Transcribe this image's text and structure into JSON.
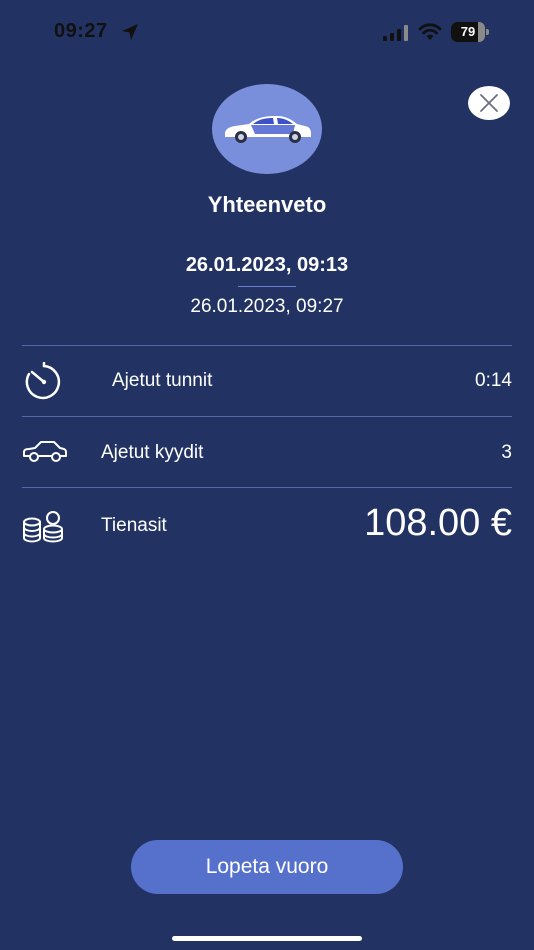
{
  "status_bar": {
    "time": "09:27",
    "battery_level": "79",
    "battery_fraction": 0.79,
    "icons": [
      "location-arrow-icon",
      "signal-icon",
      "wifi-icon",
      "battery-icon"
    ]
  },
  "header": {
    "title": "Yhteenveto",
    "avatar_icon": "car-icon",
    "close_icon": "close-icon"
  },
  "shift": {
    "start": "26.01.2023, 09:13",
    "end": "26.01.2023, 09:27"
  },
  "summary": {
    "rows": [
      {
        "icon": "stopwatch-icon",
        "label": "Ajetut tunnit",
        "value": "0:14"
      },
      {
        "icon": "car-outline-icon",
        "label": "Ajetut kyydit",
        "value": "3"
      },
      {
        "icon": "coins-icon",
        "label": "Tienasit",
        "value": "108.00 €"
      }
    ]
  },
  "actions": {
    "end_shift_label": "Lopeta vuoro"
  },
  "colors": {
    "background": "#223363",
    "accent": "#5671cc",
    "avatar_bg": "#7a8fdc"
  }
}
